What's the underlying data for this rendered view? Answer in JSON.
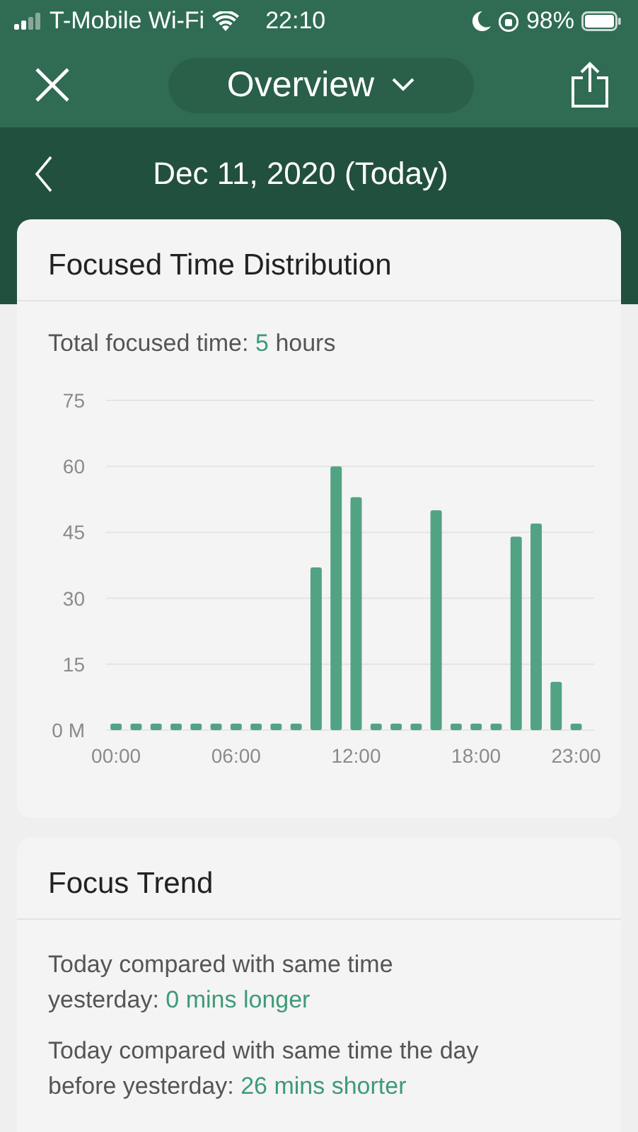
{
  "status_bar": {
    "carrier": "T-Mobile Wi-Fi",
    "time": "22:10",
    "battery": "98%"
  },
  "header": {
    "title": "Overview"
  },
  "date_bar": {
    "date": "Dec 11, 2020 (Today)"
  },
  "distribution": {
    "title": "Focused Time Distribution",
    "total_label": "Total focused time:",
    "total_value": "5",
    "total_unit": "hours",
    "chart_data": {
      "type": "bar",
      "x": [
        0,
        1,
        2,
        3,
        4,
        5,
        6,
        7,
        8,
        9,
        10,
        11,
        12,
        13,
        14,
        15,
        16,
        17,
        18,
        19,
        20,
        21,
        22,
        23
      ],
      "grid": true,
      "xlim": [
        -0.5,
        23.9
      ],
      "series": [
        {
          "color": "#52a384",
          "values": [
            1.5,
            1.5,
            1.5,
            1.5,
            1.5,
            1.5,
            1.5,
            1.5,
            1.5,
            1.5,
            37,
            60,
            53,
            1.5,
            1.5,
            1.5,
            50,
            1.5,
            1.5,
            1.5,
            44,
            47,
            11,
            1.5
          ]
        }
      ],
      "ylim": [
        0,
        75
      ],
      "yticks": [
        {
          "value": 0,
          "label": "0 M"
        },
        15,
        30,
        45,
        60,
        75
      ],
      "xticks": [
        {
          "value": 0,
          "label": "00:00"
        },
        {
          "value": 6,
          "label": "06:00"
        },
        {
          "value": 12,
          "label": "12:00"
        },
        {
          "value": 18,
          "label": "18:00"
        },
        {
          "value": 23,
          "label": "23:00"
        }
      ]
    }
  },
  "trend": {
    "title": "Focus Trend",
    "comparisons": [
      {
        "text": "Today compared with same time yesterday:",
        "value": "0 mins longer"
      },
      {
        "text": "Today compared with same time the day before yesterday:",
        "value": "26 mins shorter"
      }
    ]
  }
}
